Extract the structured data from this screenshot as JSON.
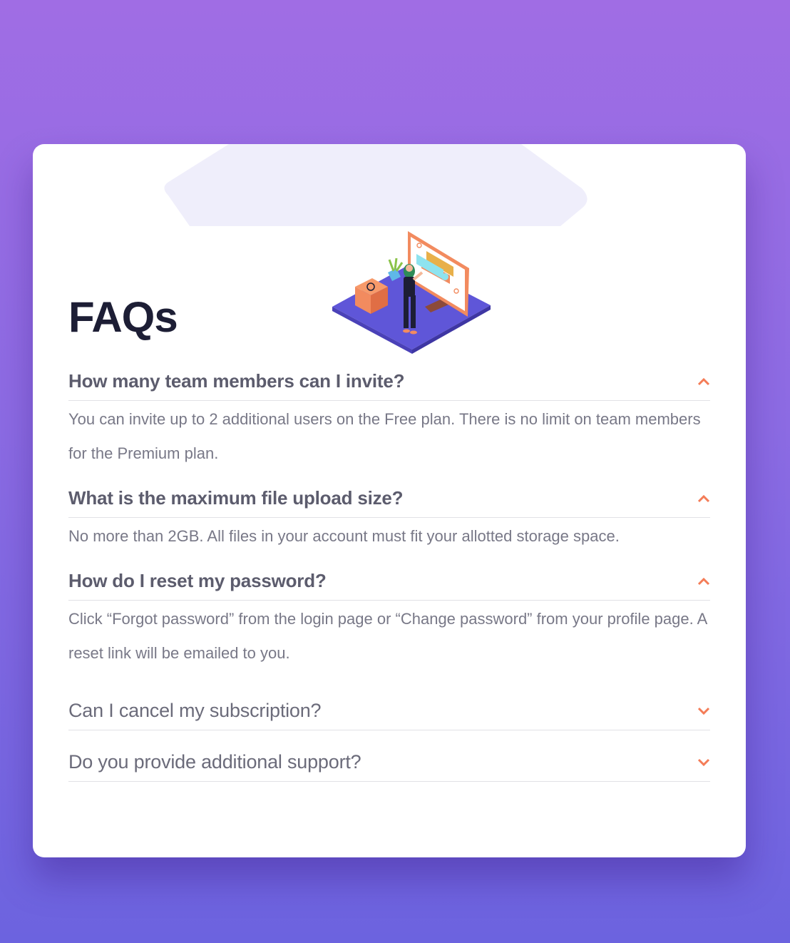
{
  "page": {
    "title": "FAQs"
  },
  "colors": {
    "accent": "#f47c57",
    "title": "#1d1e35",
    "question": "#5c5c6d",
    "answer": "#787887",
    "divider": "#e1e1e6",
    "gradient_top": "#a06de4",
    "gradient_bottom": "#6c63df"
  },
  "faqs": [
    {
      "question": "How many team members can I invite?",
      "answer": "You can invite up to 2 additional users on the Free plan. There is no limit on team members for the Premium plan.",
      "expanded": true,
      "icon": "chevron-up-icon"
    },
    {
      "question": "What is the maximum file upload size?",
      "answer": "No more than 2GB. All files in your account must fit your allotted storage space.",
      "expanded": true,
      "icon": "chevron-up-icon"
    },
    {
      "question": "How do I reset my password?",
      "answer": "Click “Forgot password” from the login page or “Change password” from your profile page. A reset link will be emailed to you.",
      "expanded": true,
      "icon": "chevron-up-icon"
    },
    {
      "question": "Can I cancel my subscription?",
      "expanded": false,
      "icon": "chevron-down-icon"
    },
    {
      "question": "Do you provide additional support?",
      "expanded": false,
      "icon": "chevron-down-icon"
    }
  ]
}
